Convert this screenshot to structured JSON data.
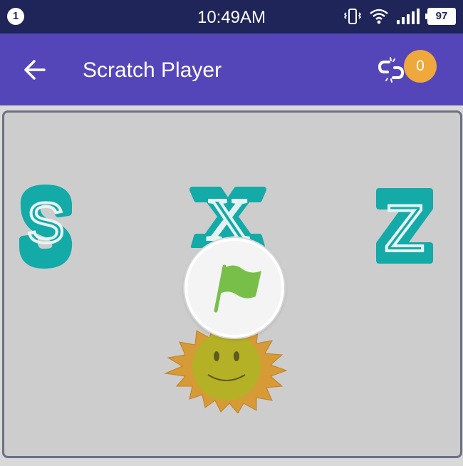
{
  "status_bar": {
    "notification_count": "1",
    "time": "10:49AM",
    "battery_level": "97",
    "icons": [
      "vibrate-icon",
      "wifi-icon",
      "signal-icon",
      "battery-icon"
    ]
  },
  "app_bar": {
    "title": "Scratch Player",
    "connection_count": "0",
    "icons": [
      "back-arrow-icon",
      "broken-link-icon"
    ]
  },
  "stage": {
    "sprites": [
      {
        "name": "letter-s-sprite",
        "label": "S"
      },
      {
        "name": "letter-x-sprite",
        "label": "X"
      },
      {
        "name": "letter-z-sprite",
        "label": "Z"
      },
      {
        "name": "sun-sprite",
        "label": ""
      }
    ],
    "green_flag": "green-flag-icon"
  },
  "colors": {
    "status_bar": "#1f2459",
    "app_bar": "#5446b9",
    "badge": "#efa83b",
    "sprite_teal": "#13aaa8",
    "flag_green": "#78bf4a",
    "sun_orange": "#d69a36",
    "sun_face": "#b4b127"
  }
}
